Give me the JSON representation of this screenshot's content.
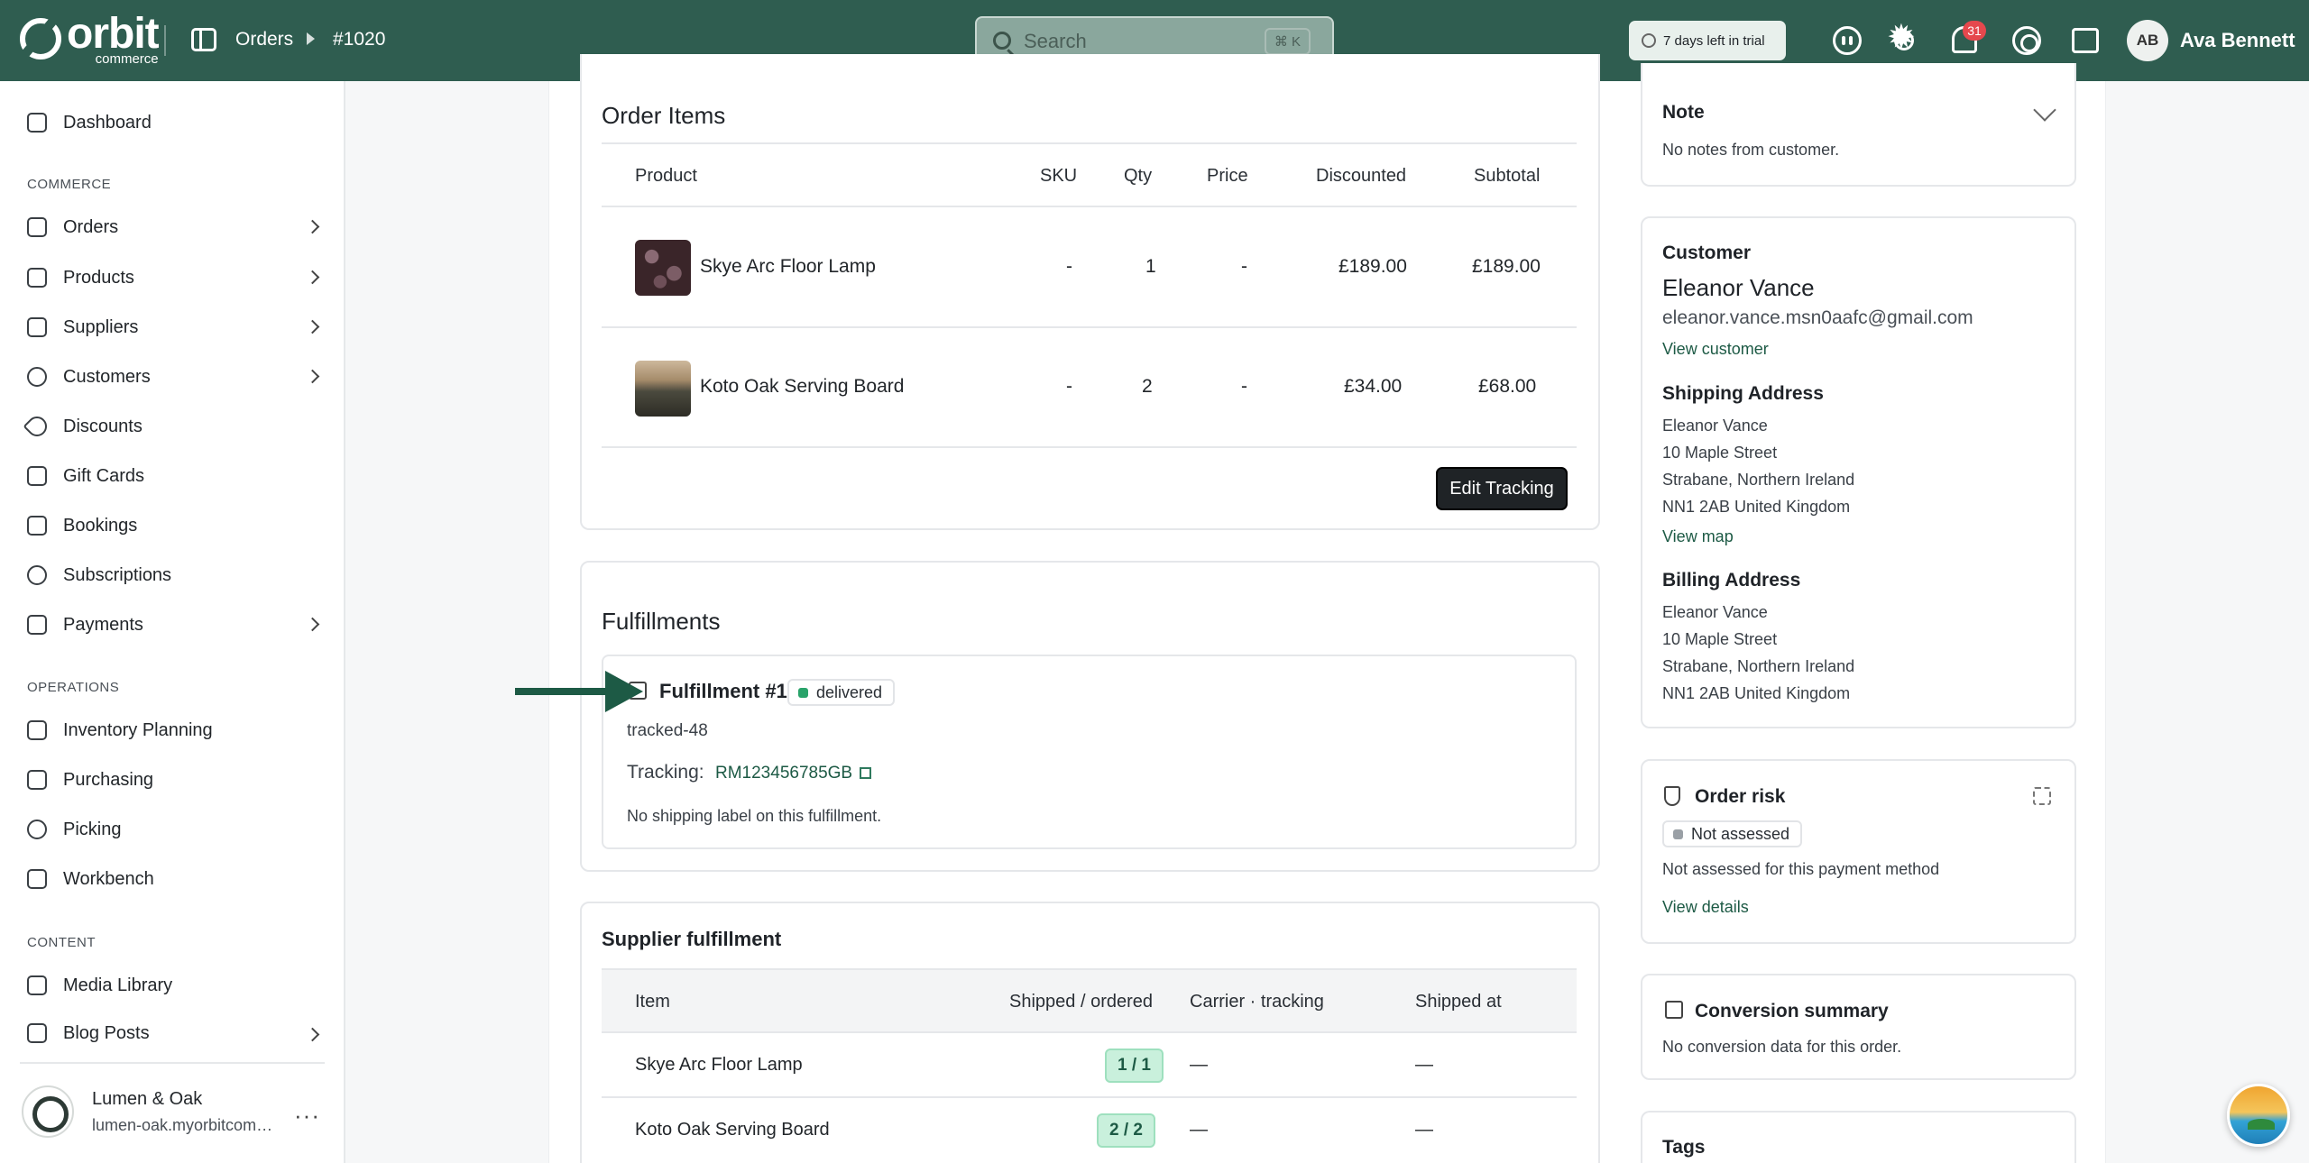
{
  "topbar": {
    "logo_word": "orbit",
    "logo_sub": "commerce",
    "breadcrumb": [
      "Orders",
      "#1020"
    ],
    "search_placeholder": "Search",
    "search_shortcut": "⌘ K",
    "trial_text": "7 days left in trial",
    "notification_count": "31",
    "avatar_initials": "AB",
    "user_name": "Ava Bennett"
  },
  "sidebar": {
    "dashboard": "Dashboard",
    "section_commerce": "COMMERCE",
    "commerce_items": [
      "Orders",
      "Products",
      "Suppliers",
      "Customers",
      "Discounts",
      "Gift Cards",
      "Bookings",
      "Subscriptions",
      "Payments"
    ],
    "section_operations": "OPERATIONS",
    "operations_items": [
      "Inventory Planning",
      "Purchasing",
      "Picking",
      "Workbench"
    ],
    "section_content": "CONTENT",
    "content_items": [
      "Media Library",
      "Blog Posts"
    ],
    "store_name": "Lumen & Oak",
    "store_url": "lumen-oak.myorbitcommerce.com"
  },
  "order_items": {
    "title": "Order Items",
    "headers": [
      "Product",
      "SKU",
      "Qty",
      "Price",
      "Discounted",
      "Subtotal"
    ],
    "rows": [
      {
        "product": "Skye Arc Floor Lamp",
        "sku": "-",
        "qty": "1",
        "price": "-",
        "discounted": "£189.00",
        "subtotal": "£189.00"
      },
      {
        "product": "Koto Oak Serving Board",
        "sku": "-",
        "qty": "2",
        "price": "-",
        "discounted": "£34.00",
        "subtotal": "£68.00"
      }
    ],
    "edit_tracking": "Edit Tracking"
  },
  "fulfillments": {
    "title": "Fulfillments",
    "name": "Fulfillment #1",
    "status": "delivered",
    "tracked_code": "tracked-48",
    "tracking_label": "Tracking:",
    "tracking_number": "RM123456785GB",
    "label_note": "No shipping label on this fulfillment."
  },
  "supplier_fulfillment": {
    "title": "Supplier fulfillment",
    "headers": [
      "Item",
      "Shipped / ordered",
      "Carrier · tracking",
      "Shipped at"
    ],
    "rows": [
      {
        "item": "Skye Arc Floor Lamp",
        "shipped": "1 / 1",
        "carrier": "—",
        "shipped_at": "—"
      },
      {
        "item": "Koto Oak Serving Board",
        "shipped": "2 / 2",
        "carrier": "—",
        "shipped_at": "—"
      }
    ]
  },
  "note": {
    "title": "Note",
    "text": "No notes from customer."
  },
  "customer": {
    "title": "Customer",
    "name": "Eleanor Vance",
    "email": "eleanor.vance.msn0aafc@gmail.com",
    "view_customer": "View customer",
    "shipping_title": "Shipping Address",
    "shipping_lines": [
      "Eleanor Vance",
      "10 Maple Street",
      "Strabane, Northern Ireland",
      "NN1 2AB United Kingdom"
    ],
    "view_map": "View map",
    "billing_title": "Billing Address",
    "billing_lines": [
      "Eleanor Vance",
      "10 Maple Street",
      "Strabane, Northern Ireland",
      "NN1 2AB United Kingdom"
    ]
  },
  "order_risk": {
    "title": "Order risk",
    "status": "Not assessed",
    "text": "Not assessed for this payment method",
    "view_details": "View details"
  },
  "conversion": {
    "title": "Conversion summary",
    "text": "No conversion data for this order."
  },
  "tags": {
    "title": "Tags"
  }
}
